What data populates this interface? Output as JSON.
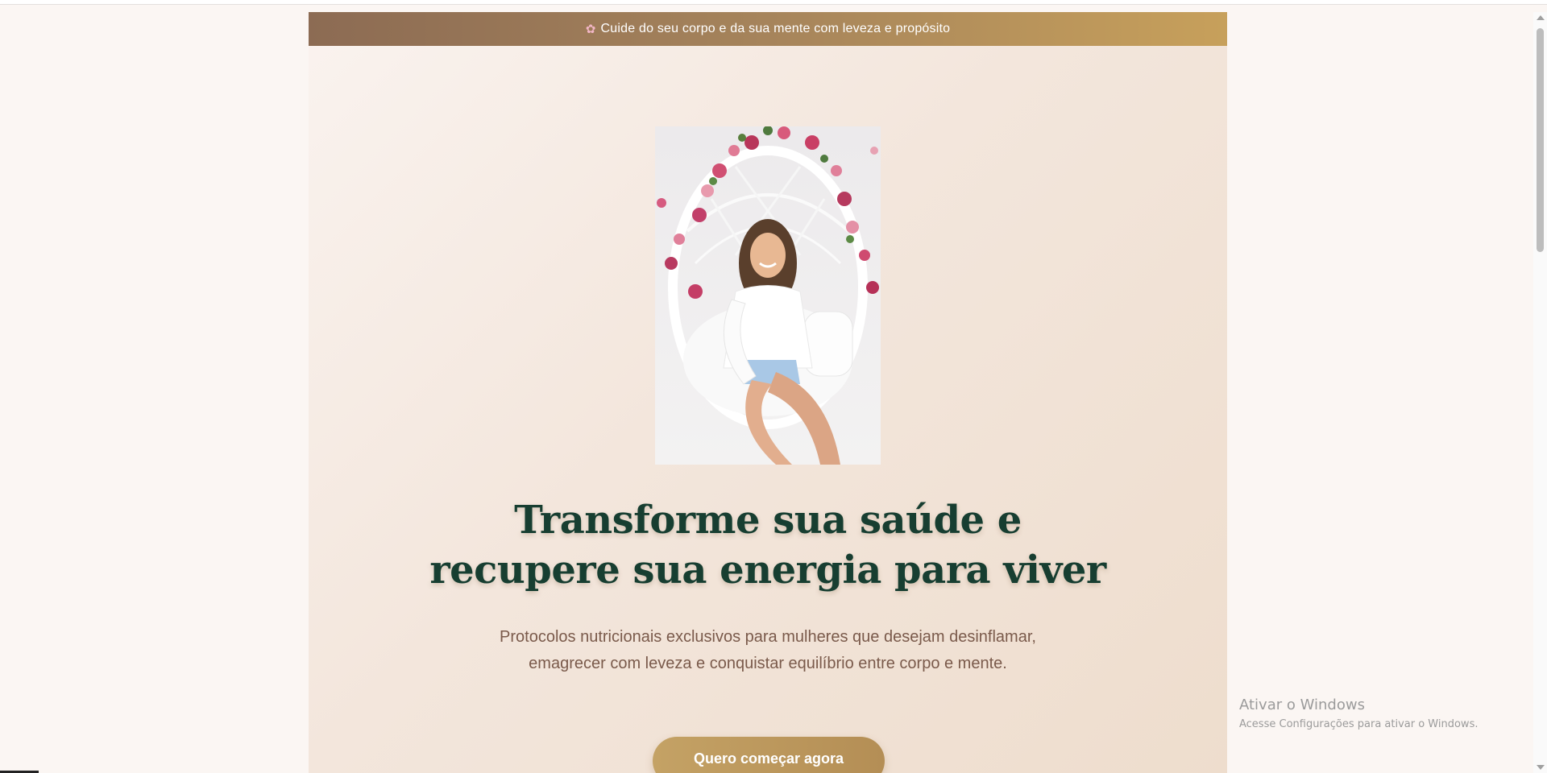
{
  "banner": {
    "icon": "flower-icon",
    "text": "Cuide do seu corpo e da sua mente com leveza e propósito"
  },
  "hero": {
    "headline_line1": "Transforme sua saúde e",
    "headline_line2": "recupere sua energia para viver",
    "subtext": "Protocolos nutricionais exclusivos para mulheres que desejam desinflamar, emagrecer com leveza e conquistar equilíbrio entre corpo e mente.",
    "cta_label": "Quero começar agora"
  },
  "watermark": {
    "title": "Ativar o Windows",
    "subtitle": "Acesse Configurações para ativar o Windows."
  },
  "colors": {
    "banner_start": "#8c6b53",
    "banner_end": "#c7a05b",
    "headline": "#173e31",
    "body_text": "#7a5a4b",
    "cta": "#c4a265"
  }
}
